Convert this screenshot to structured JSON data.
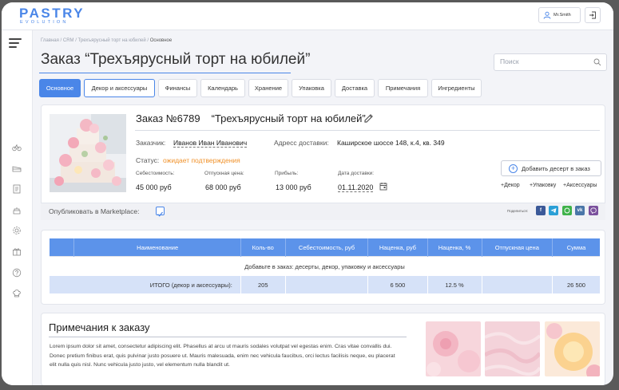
{
  "brand": {
    "name": "PASTRY",
    "subtitle": "EVOLUTION",
    "color": "#4a86e8"
  },
  "user": {
    "name": "Mr.Smith"
  },
  "breadcrumbs": [
    "Главная",
    "CRM",
    "Трехъярусный торт на юбилей",
    "Основное"
  ],
  "page": {
    "title": "Заказ “Трехъярусный торт на юбилей”"
  },
  "search": {
    "placeholder": "Поиск",
    "value": ""
  },
  "tabs": [
    {
      "label": "Основное",
      "state": "active"
    },
    {
      "label": "Декор и аксессуары",
      "state": "outlined"
    },
    {
      "label": "Финансы"
    },
    {
      "label": "Календарь"
    },
    {
      "label": "Хранение"
    },
    {
      "label": "Упаковка"
    },
    {
      "label": "Доставка"
    },
    {
      "label": "Примечания"
    },
    {
      "label": "Ингредиенты"
    }
  ],
  "order": {
    "number": "Заказ №6789",
    "name": "“Трехъярусный торт на юбилей”",
    "customer_label": "Заказчик:",
    "customer": "Иванов Иван Иванович",
    "address_label": "Адресс доставки:",
    "address": "Каширское шоссе 148, к.4, кв. 349",
    "status_label": "Статус:",
    "status": "ожидает подтверждения",
    "status_color": "#f0922b",
    "cost_label": "Себестоимость:",
    "cost": "45 000 руб",
    "price_label": "Отпускная цена:",
    "price": "68 000 руб",
    "profit_label": "Прибыль:",
    "profit": "13 000 руб",
    "date_label": "Дата доставки:",
    "date": "01.11.2020",
    "add_dessert": "Добавить десерт в заказ",
    "extras": [
      "+Декор",
      "+Упаковку",
      "+Аксессуары"
    ]
  },
  "publish": {
    "label": "Опубликовать в Marketplace:",
    "checked": true,
    "share_label": "Поделиться:",
    "socials": [
      "f",
      "t",
      "w",
      "vk",
      "v"
    ]
  },
  "table": {
    "headers": [
      "",
      "Наименование",
      "Коль-во",
      "Себестоимость, руб",
      "Наценка, руб",
      "Наценка, %",
      "Отпускная цена",
      "Сумма"
    ],
    "add_text": "Добавьте в заказ: десерты, декор, упаковку и аксессуары",
    "total": {
      "label": "ИТОГО (декор и аксессуары):",
      "qty": "205",
      "cost": "",
      "markup_rub": "6 500",
      "markup_pct": "12.5 %",
      "price": "",
      "sum": "26 500"
    }
  },
  "notes": {
    "title": "Примечания к заказу",
    "text": "Lorem ipsum dolor sit amet, consectetur adipiscing elit. Phasellus at arcu ut mauris sodales volutpat vel egestas enim. Cras vitae convallis dui. Donec pretium finibus erat, quis pulvinar justo posuere ut. Mauris malesuada, enim nec vehicula faucibus, orci lectus facilisis neque, eu placerat elit nulla quis nisl. Nunc vehicula justo justo, vel elementum nulla blandit ut."
  }
}
